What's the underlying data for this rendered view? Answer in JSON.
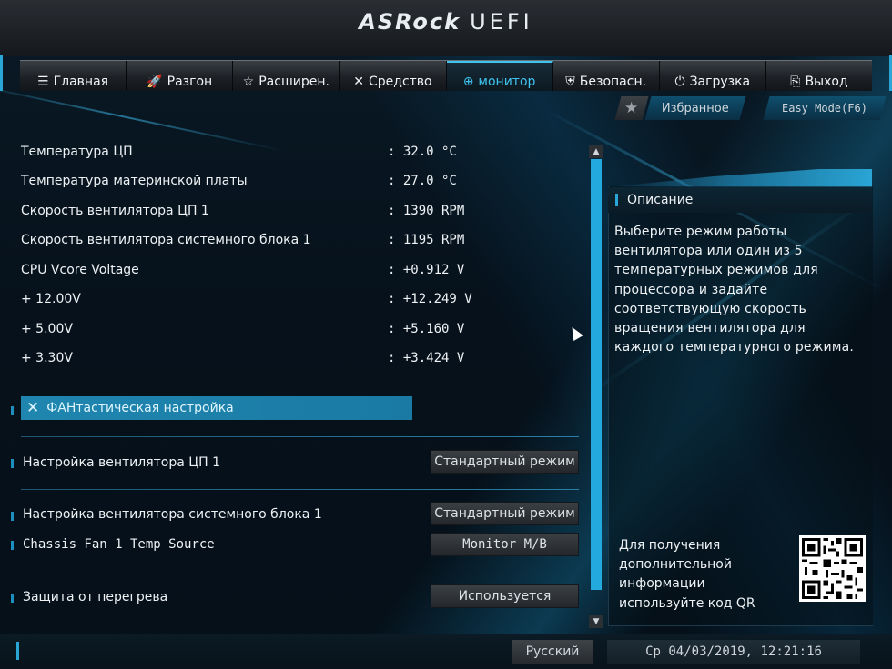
{
  "header": {
    "logo_brand": "ASRock",
    "logo_product": "UEFI"
  },
  "tabs": [
    {
      "label": "Главная",
      "icon": "list-icon",
      "glyph": "☰",
      "active": false
    },
    {
      "label": "Разгон",
      "icon": "rocket-icon",
      "glyph": "🚀",
      "active": false
    },
    {
      "label": "Расширен.",
      "icon": "star-icon",
      "glyph": "☆",
      "active": false
    },
    {
      "label": "Средство",
      "icon": "tools-icon",
      "glyph": "✕",
      "active": false
    },
    {
      "label": "монитор",
      "icon": "monitor-icon",
      "glyph": "⊕",
      "active": true
    },
    {
      "label": "Безопасн.",
      "icon": "shield-icon",
      "glyph": "⛨",
      "active": false
    },
    {
      "label": "Загрузка",
      "icon": "power-icon",
      "glyph": "⏻",
      "active": false
    },
    {
      "label": "Выход",
      "icon": "exit-icon",
      "glyph": "⎘",
      "active": false
    }
  ],
  "favorites": {
    "label": "Избранное",
    "icon": "star-icon"
  },
  "easy_mode": {
    "label": "Easy Mode(F6)"
  },
  "readings": [
    {
      "label": "Температура ЦП",
      "value": ": 32.0 °C"
    },
    {
      "label": "Температура материнской платы",
      "value": ": 27.0 °C"
    },
    {
      "label": "Скорость вентилятора ЦП 1",
      "value": ": 1390 RPM"
    },
    {
      "label": "Скорость вентилятора системного блока 1",
      "value": ": 1195 RPM"
    },
    {
      "label": "CPU Vcore Voltage",
      "value": ": +0.912 V"
    },
    {
      "label": "+ 12.00V",
      "value": ": +12.249 V"
    },
    {
      "label": "+ 5.00V",
      "value": ": +5.160 V"
    },
    {
      "label": "+ 3.30V",
      "value": ": +3.424 V"
    }
  ],
  "fan_tuning": {
    "label": "ФАНтастическая настройка",
    "icon": "tools-icon"
  },
  "settings": [
    {
      "label": "Настройка вентилятора ЦП 1",
      "value": "Стандартный режим"
    },
    {
      "label": "Настройка вентилятора системного блока 1",
      "value": "Стандартный режим"
    },
    {
      "label": "Chassis Fan 1 Temp Source",
      "value": "Monitor M/B"
    },
    {
      "label": "Защита от перегрева",
      "value": "Используется"
    }
  ],
  "description": {
    "title": "Описание",
    "lines": [
      "Выберите режим работы",
      "вентилятора или один из 5",
      "температурных режимов для",
      "процессора и задайте",
      "соответствующую скорость",
      "вращения вентилятора для",
      "каждого температурного режима."
    ],
    "info_lines": [
      "Для получения",
      "дополнительной",
      "информации",
      "используйте код QR"
    ]
  },
  "footer": {
    "language": "Русский",
    "datetime": "Ср 04/03/2019, 12:21:16"
  },
  "colors": {
    "accent": "#24a9df",
    "highlight": "#1f86b0",
    "background": "#06121c"
  }
}
